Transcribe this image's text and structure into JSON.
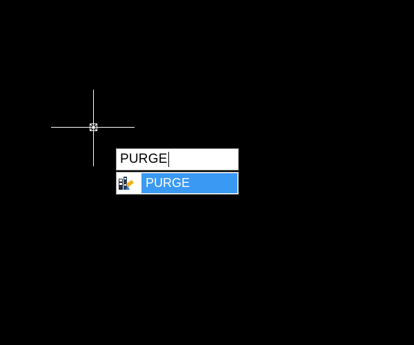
{
  "canvas": {
    "background": "#000000",
    "cursor_icon": "crosshair-icon",
    "pickbox_icon": "pickbox-icon"
  },
  "command_line": {
    "value": "PURGE"
  },
  "autocomplete": {
    "items": [
      {
        "label": "PURGE",
        "icon": "purge-command-icon",
        "highlighted": true,
        "highlight_color": "#3a99f3"
      }
    ]
  }
}
